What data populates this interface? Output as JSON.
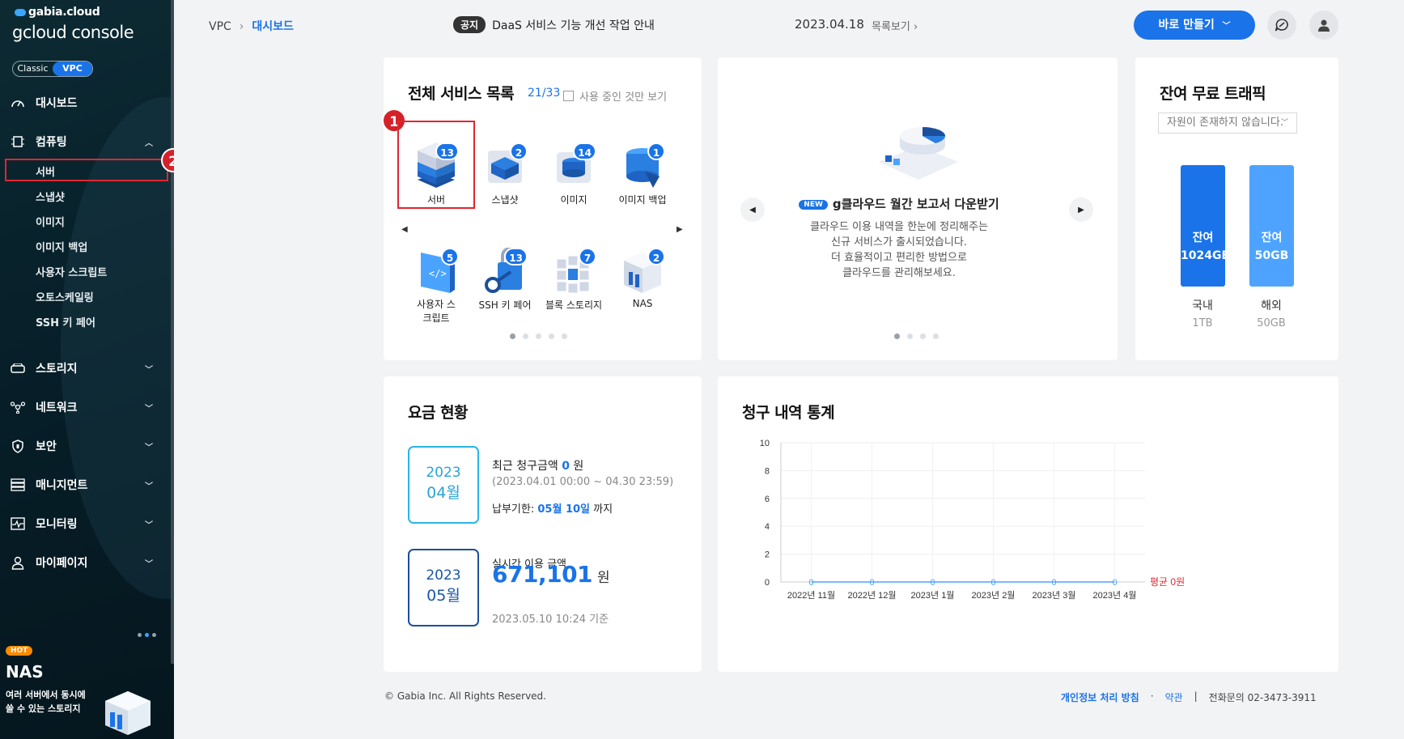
{
  "brand": {
    "line1": "gabia.cloud",
    "line2": "gcloud console"
  },
  "env_toggle": {
    "classic": "Classic",
    "vpc": "VPC"
  },
  "sidebar": {
    "dashboard": "대시보드",
    "computing": "컴퓨팅",
    "computing_items": [
      "서버",
      "스냅샷",
      "이미지",
      "이미지 백업",
      "사용자 스크립트",
      "오토스케일링",
      "SSH 키 페어"
    ],
    "storage": "스토리지",
    "network": "네트워크",
    "security": "보안",
    "management": "매니지먼트",
    "monitoring": "모니터링",
    "mypage": "마이페이지"
  },
  "promo": {
    "hot": "HOT",
    "title": "NAS",
    "desc1": "여러 서버에서 동시에",
    "desc2": "쓸 수 있는 스토리지"
  },
  "annotations": {
    "step1": "1",
    "step2": "2"
  },
  "header": {
    "breadcrumb_root": "VPC",
    "breadcrumb_sep": "›",
    "breadcrumb_current": "대시보드",
    "notice_tag": "공지",
    "notice_text": "DaaS 서비스 기능 개선 작업 안내",
    "notice_date": "2023.04.18",
    "notice_more": "목록보기",
    "make_button": "바로 만들기"
  },
  "services": {
    "title": "전체 서비스 목록",
    "count": "21/33",
    "filter_label": "사용 중인 것만 보기",
    "items": [
      {
        "label": "서버",
        "count": "13"
      },
      {
        "label": "스냅샷",
        "count": "2"
      },
      {
        "label": "이미지",
        "count": "14"
      },
      {
        "label": "이미지 백업",
        "count": "1"
      },
      {
        "label": "사용자 스크립트",
        "count": "5"
      },
      {
        "label": "SSH 키 페어",
        "count": "13"
      },
      {
        "label": "블록 스토리지",
        "count": "7"
      },
      {
        "label": "NAS",
        "count": "2"
      }
    ]
  },
  "banner": {
    "new_tag": "NEW",
    "title": "g클라우드 월간 보고서 다운받기",
    "desc": [
      "클라우드 이용 내역을 한눈에 정리해주는",
      "신규 서비스가 출시되었습니다.",
      "더 효율적이고 편리한 방법으로",
      "클라우드를 관리해보세요."
    ]
  },
  "traffic": {
    "title": "잔여 무료 트래픽",
    "select": "자원이 존재하지 않습니다.",
    "domestic": {
      "bar1": "잔여",
      "bar2": "1024GB",
      "label": "국내",
      "total": "1TB",
      "color": "#1a73e8"
    },
    "overseas": {
      "bar1": "잔여",
      "bar2": "50GB",
      "label": "해외",
      "total": "50GB",
      "color": "#4da3ff"
    }
  },
  "fees": {
    "title": "요금 현황",
    "box1": {
      "year": "2023",
      "month": "04월"
    },
    "recent_label": "최근 청구금액",
    "recent_amount": "0",
    "recent_unit": "원",
    "period": "(2023.04.01 00:00 ~ 04.30 23:59)",
    "due_label": "납부기한:",
    "due_date": "05월 10일",
    "due_suffix": "까지",
    "box2": {
      "year": "2023",
      "month": "05월"
    },
    "realtime_label": "실시간 이용 금액",
    "realtime_amount": "671,101",
    "realtime_unit": "원",
    "realtime_time": "2023.05.10 10:24 기준"
  },
  "billing_chart": {
    "title": "청구 내역 통계",
    "avg_label": "평균 0원"
  },
  "chart_data": {
    "type": "line",
    "title": "청구 내역 통계",
    "categories": [
      "2022년 11월",
      "2022년 12월",
      "2023년 1월",
      "2023년 2월",
      "2023년 3월",
      "2023년 4월"
    ],
    "values": [
      0,
      0,
      0,
      0,
      0,
      0
    ],
    "yticks": [
      0,
      2,
      4,
      6,
      8,
      10
    ],
    "ylim": [
      0,
      10
    ],
    "grid": true,
    "annotation": "평균 0원"
  },
  "footer": {
    "copyright": "© Gabia Inc. All Rights Reserved.",
    "privacy": "개인정보 처리 방침",
    "dot": "·",
    "terms": "약관",
    "bar": "|",
    "phone": "전화문의  02-3473-3911"
  }
}
